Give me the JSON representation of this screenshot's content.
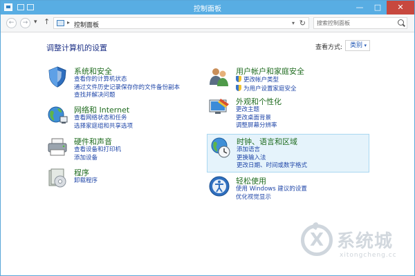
{
  "window": {
    "title": "控制面板",
    "minimize_glyph": "—",
    "maximize_glyph": "□",
    "close_glyph": "✕"
  },
  "nav": {
    "back_glyph": "←",
    "forward_glyph": "→",
    "recent_glyph": "▾",
    "up_glyph": "↑"
  },
  "address": {
    "separator": "▸",
    "crumb": "控制面板",
    "dropdown_glyph": "▾",
    "refresh_glyph": "↻"
  },
  "search": {
    "placeholder": "搜索控制面板"
  },
  "main": {
    "heading": "调整计算机的设置",
    "view_by_label": "查看方式:",
    "view_by_value": "类别",
    "view_by_arrow": "▾"
  },
  "categories": [
    {
      "title": "系统和安全",
      "icon": "system-security-icon",
      "links": [
        "查看你的计算机状态",
        "通过文件历史记录保存你的文件备份副本",
        "查找并解决问题"
      ]
    },
    {
      "title": "网络和 Internet",
      "icon": "network-internet-icon",
      "links": [
        "查看网络状态和任务",
        "选择家庭组和共享选项"
      ]
    },
    {
      "title": "硬件和声音",
      "icon": "hardware-sound-icon",
      "links": [
        "查看设备和打印机",
        "添加设备"
      ]
    },
    {
      "title": "程序",
      "icon": "programs-icon",
      "links": [
        "卸载程序"
      ]
    },
    {
      "title": "用户帐户和家庭安全",
      "icon": "user-accounts-icon",
      "links": [
        "更改帐户类型",
        "为用户设置家庭安全"
      ]
    },
    {
      "title": "外观和个性化",
      "icon": "appearance-icon",
      "links": [
        "更改主题",
        "更改桌面背景",
        "调整屏幕分辨率"
      ]
    },
    {
      "title": "时钟、语言和区域",
      "icon": "clock-language-region-icon",
      "links": [
        "添加语言",
        "更换输入法",
        "更改日期、时间或数字格式"
      ]
    },
    {
      "title": "轻松使用",
      "icon": "ease-of-access-icon",
      "links": [
        "使用 Windows 建议的设置",
        "优化视觉显示"
      ]
    }
  ],
  "watermark": {
    "text": "系统城",
    "subtext": "xitongcheng.cc"
  },
  "colors": {
    "titlebar": "#58ade3",
    "category_title": "#1f6b1f",
    "link": "#1f46a8",
    "heading": "#1e3287",
    "highlight_bg": "#e5f3fb"
  }
}
